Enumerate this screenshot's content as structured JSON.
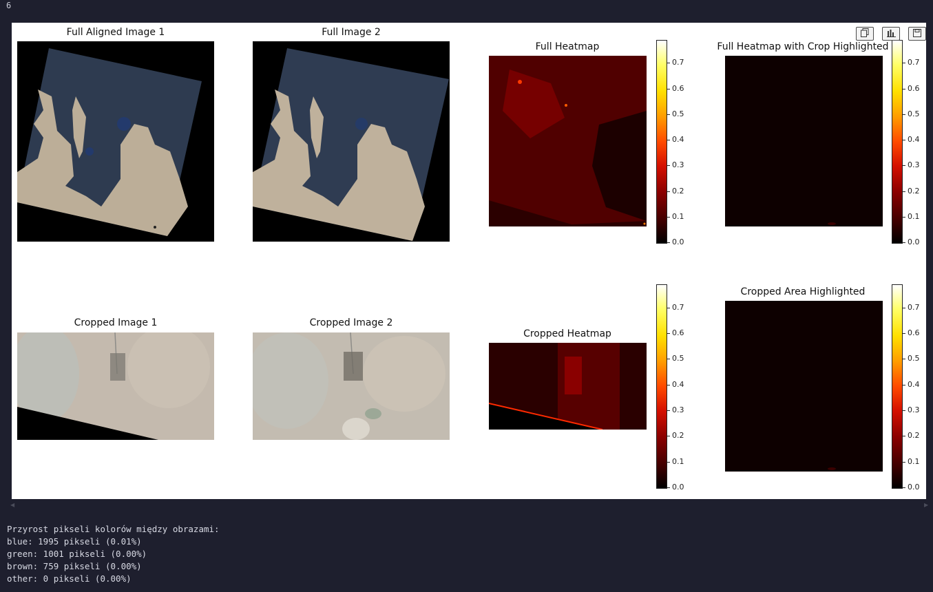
{
  "cell": {
    "execution_count": "6"
  },
  "figure": {
    "titles": {
      "full_aligned_1": "Full Aligned Image 1",
      "full_2": "Full Image 2",
      "full_heatmap": "Full Heatmap",
      "full_heatmap_crop": "Full Heatmap with Crop Highlighted",
      "cropped_1": "Cropped Image 1",
      "cropped_2": "Cropped Image 2",
      "cropped_heatmap": "Cropped Heatmap",
      "cropped_area": "Cropped Area Highlighted"
    },
    "colorbar": {
      "colormap": "hot",
      "ticks": [
        "0.0",
        "0.1",
        "0.2",
        "0.3",
        "0.4",
        "0.5",
        "0.6",
        "0.7"
      ],
      "range": [
        0.0,
        0.79
      ]
    },
    "toolbar": {
      "copy_icon": "copy-icon",
      "chart_icon": "chart-icon",
      "save_icon": "save-icon"
    }
  },
  "output": {
    "header": "Przyrost pikseli kolorów między obrazami:",
    "lines": [
      "blue: 1995 pikseli (0.01%)",
      "green: 1001 pikseli (0.00%)",
      "brown: 759 pikseli (0.00%)",
      "other: 0 pikseli (0.00%)"
    ]
  },
  "colors": {
    "notebook_bg": "#1e1f2e",
    "figure_bg": "#ffffff",
    "sea": "#2d3b52",
    "land": "#bfb19c",
    "heat_dark": "#1a0000",
    "heat_red": "#a00000"
  }
}
